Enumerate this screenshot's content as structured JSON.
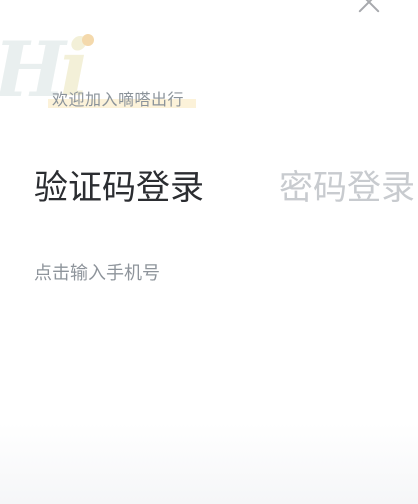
{
  "logo": {
    "text_h": "H",
    "text_i": "i"
  },
  "welcome_text": "欢迎加入嘀嗒出行",
  "tabs": [
    {
      "label": "验证码登录",
      "active": true
    },
    {
      "label": "密码登录",
      "active": false
    }
  ],
  "phone_input": {
    "placeholder": "点击输入手机号",
    "value": ""
  },
  "close_icon": "close-icon",
  "colors": {
    "active_tab": "#2b2d31",
    "inactive_tab": "#c8cbcf",
    "placeholder": "#8e949b",
    "welcome": "#8b939a",
    "highlight": "#fbf0d2"
  }
}
